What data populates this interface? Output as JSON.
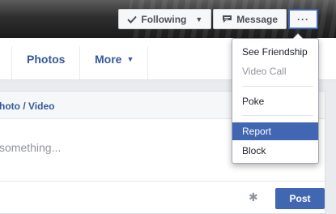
{
  "cover_actions": {
    "following_label": "Following",
    "message_label": "Message",
    "more_label": "···"
  },
  "nav": {
    "photos_label": "Photos",
    "more_label": "More",
    "more_caret": "▼",
    "following_caret": "▼"
  },
  "composer": {
    "header_label": "hoto / Video",
    "placeholder": "something...",
    "post_label": "Post",
    "settings_icon": "✱"
  },
  "menu": {
    "items": [
      {
        "label": "See Friendship",
        "state": "normal"
      },
      {
        "label": "Video Call",
        "state": "disabled"
      },
      {
        "label": "Poke",
        "state": "normal"
      },
      {
        "label": "Report",
        "state": "highlighted"
      },
      {
        "label": "Block",
        "state": "normal"
      }
    ]
  },
  "colors": {
    "accent": "#4267b2",
    "link": "#365899",
    "muted": "#90949c"
  }
}
